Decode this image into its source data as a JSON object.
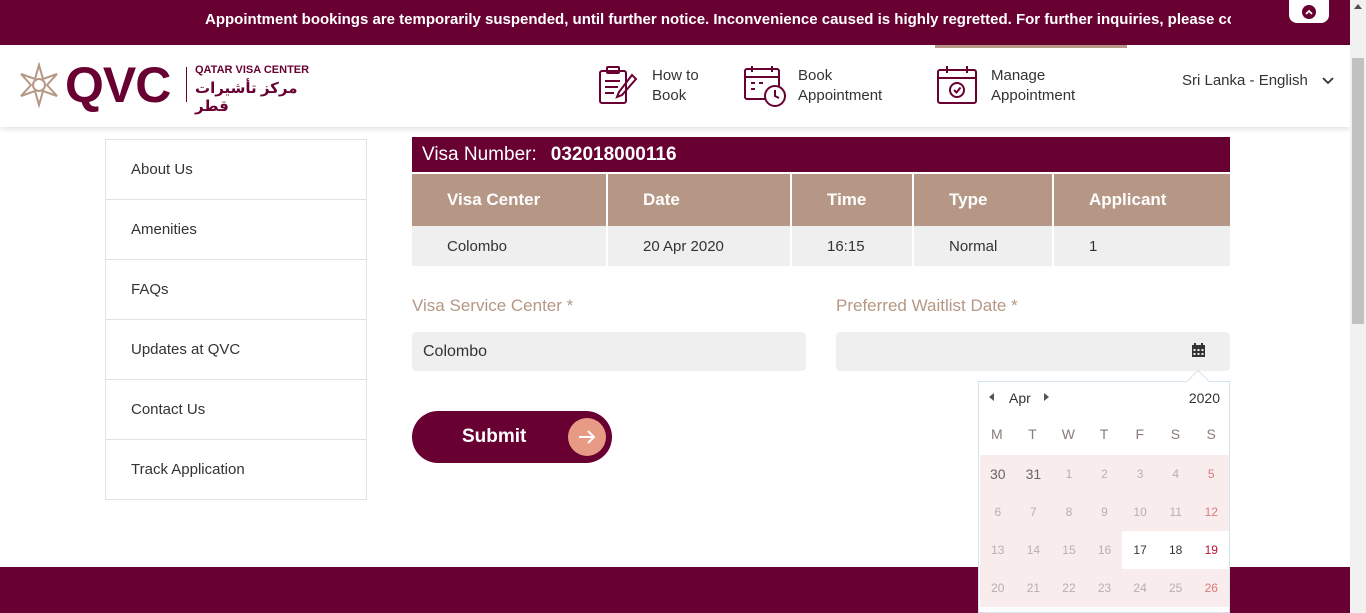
{
  "announcement": {
    "text": "Appointment bookings are temporarily suspended, until further notice. Inconvenience caused is highly regretted. For further inquiries, please co"
  },
  "header": {
    "logo_text": "QVC",
    "logo_en": "QATAR VISA CENTER",
    "logo_ar": "مركز تأشيرات قطر",
    "nav": [
      {
        "line1": "How to",
        "line2": "Book",
        "icon": "clipboard-pen-icon"
      },
      {
        "line1": "Book",
        "line2": "Appointment",
        "icon": "calendar-clock-icon"
      },
      {
        "line1": "Manage",
        "line2": "Appointment",
        "icon": "calendar-check-icon"
      }
    ],
    "language": "Sri Lanka - English"
  },
  "sidebar": {
    "items": [
      "About Us",
      "Amenities",
      "FAQs",
      "Updates at QVC",
      "Contact Us",
      "Track Application"
    ]
  },
  "visa": {
    "label": "Visa Number:",
    "number": "032018000116"
  },
  "table": {
    "headers": [
      "Visa Center",
      "Date",
      "Time",
      "Type",
      "Applicant"
    ],
    "row": [
      "Colombo",
      "20 Apr 2020",
      "16:15",
      "Normal",
      "1"
    ]
  },
  "form": {
    "service_center_label": "Visa Service Center *",
    "service_center_value": "Colombo",
    "waitlist_label": "Preferred Waitlist Date *",
    "waitlist_value": "",
    "submit_label": "Submit"
  },
  "datepicker": {
    "month": "Apr",
    "year": "2020",
    "dow": [
      "M",
      "T",
      "W",
      "T",
      "F",
      "S",
      "S"
    ],
    "weeks": [
      [
        "30",
        "31",
        "1",
        "2",
        "3",
        "4",
        "5"
      ],
      [
        "6",
        "7",
        "8",
        "9",
        "10",
        "11",
        "12"
      ],
      [
        "13",
        "14",
        "15",
        "16",
        "17",
        "18",
        "19"
      ],
      [
        "20",
        "21",
        "22",
        "23",
        "24",
        "25",
        "26"
      ]
    ],
    "available": [
      "17",
      "18",
      "19"
    ]
  },
  "colors": {
    "brand": "#680032",
    "accent": "#b69785",
    "arrow": "#e79b85"
  }
}
